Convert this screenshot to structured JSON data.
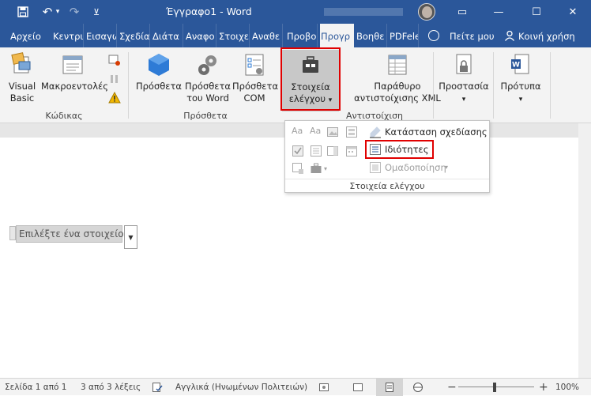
{
  "titlebar": {
    "title": "Έγγραφο1 - Word",
    "icons": [
      "save-icon",
      "undo-icon",
      "redo-icon",
      "customize-quick-access-icon",
      "ribbon-display-options-icon",
      "minimize-icon",
      "maximize-icon",
      "close-icon"
    ],
    "undo_glyph": "↶",
    "undo_arrow": "▾",
    "redo_glyph": "↷",
    "qat_glyph": "⊻",
    "restore_glyph": "▭",
    "minimize_glyph": "—",
    "maximize_glyph": "☐",
    "close_glyph": "✕"
  },
  "tabs": [
    {
      "label": "Αρχείο"
    },
    {
      "label": "Κεντρι"
    },
    {
      "label": "Εισαγω"
    },
    {
      "label": "Σχεδία"
    },
    {
      "label": "Διάτα"
    },
    {
      "label": "Αναφο"
    },
    {
      "label": "Στοιχε"
    },
    {
      "label": "Αναθε"
    },
    {
      "label": "Προβο"
    },
    {
      "label": "Προγρ"
    },
    {
      "label": "Βοηθε"
    },
    {
      "label": "PDFele"
    },
    {
      "label": "Πείτε μου"
    },
    {
      "label": "Κοινή χρήση"
    }
  ],
  "ribbon": {
    "visual_basic": "Visual Basic",
    "macros": "Μακροεντολές",
    "group_code": "Κώδικας",
    "addins": "Πρόσθετα",
    "word_addins": "Πρόσθετα του Word",
    "com_addins": "Πρόσθετα COM",
    "group_addins": "Πρόσθετα",
    "controls": "Στοιχεία ελέγχου",
    "xml_mapping": "Παράθυρο αντιστοίχισης XML",
    "group_mapping": "Αντιστοίχιση",
    "protection": "Προστασία",
    "templates": "Πρότυπα",
    "dropdown_arrow": "▾"
  },
  "dropdown": {
    "design_mode": "Κατάσταση σχεδίασης",
    "properties": "Ιδιότητες",
    "grouping": "Ομαδοποίηση",
    "footer": "Στοιχεία ελέγχου",
    "grid_labels": [
      "Aa",
      "Aa"
    ]
  },
  "document": {
    "content_control_text": "Επιλέξτε ένα στοιχείο.",
    "dropdown_arrow": "▼"
  },
  "statusbar": {
    "page": "Σελίδα 1 από 1",
    "words": "3 από 3 λέξεις",
    "language": "Αγγλικά (Ηνωμένων Πολιτειών)",
    "zoom": "100%",
    "zoom_minus": "−",
    "zoom_plus": "+"
  },
  "colors": {
    "accent": "#2b579a",
    "highlight": "#e00000"
  }
}
